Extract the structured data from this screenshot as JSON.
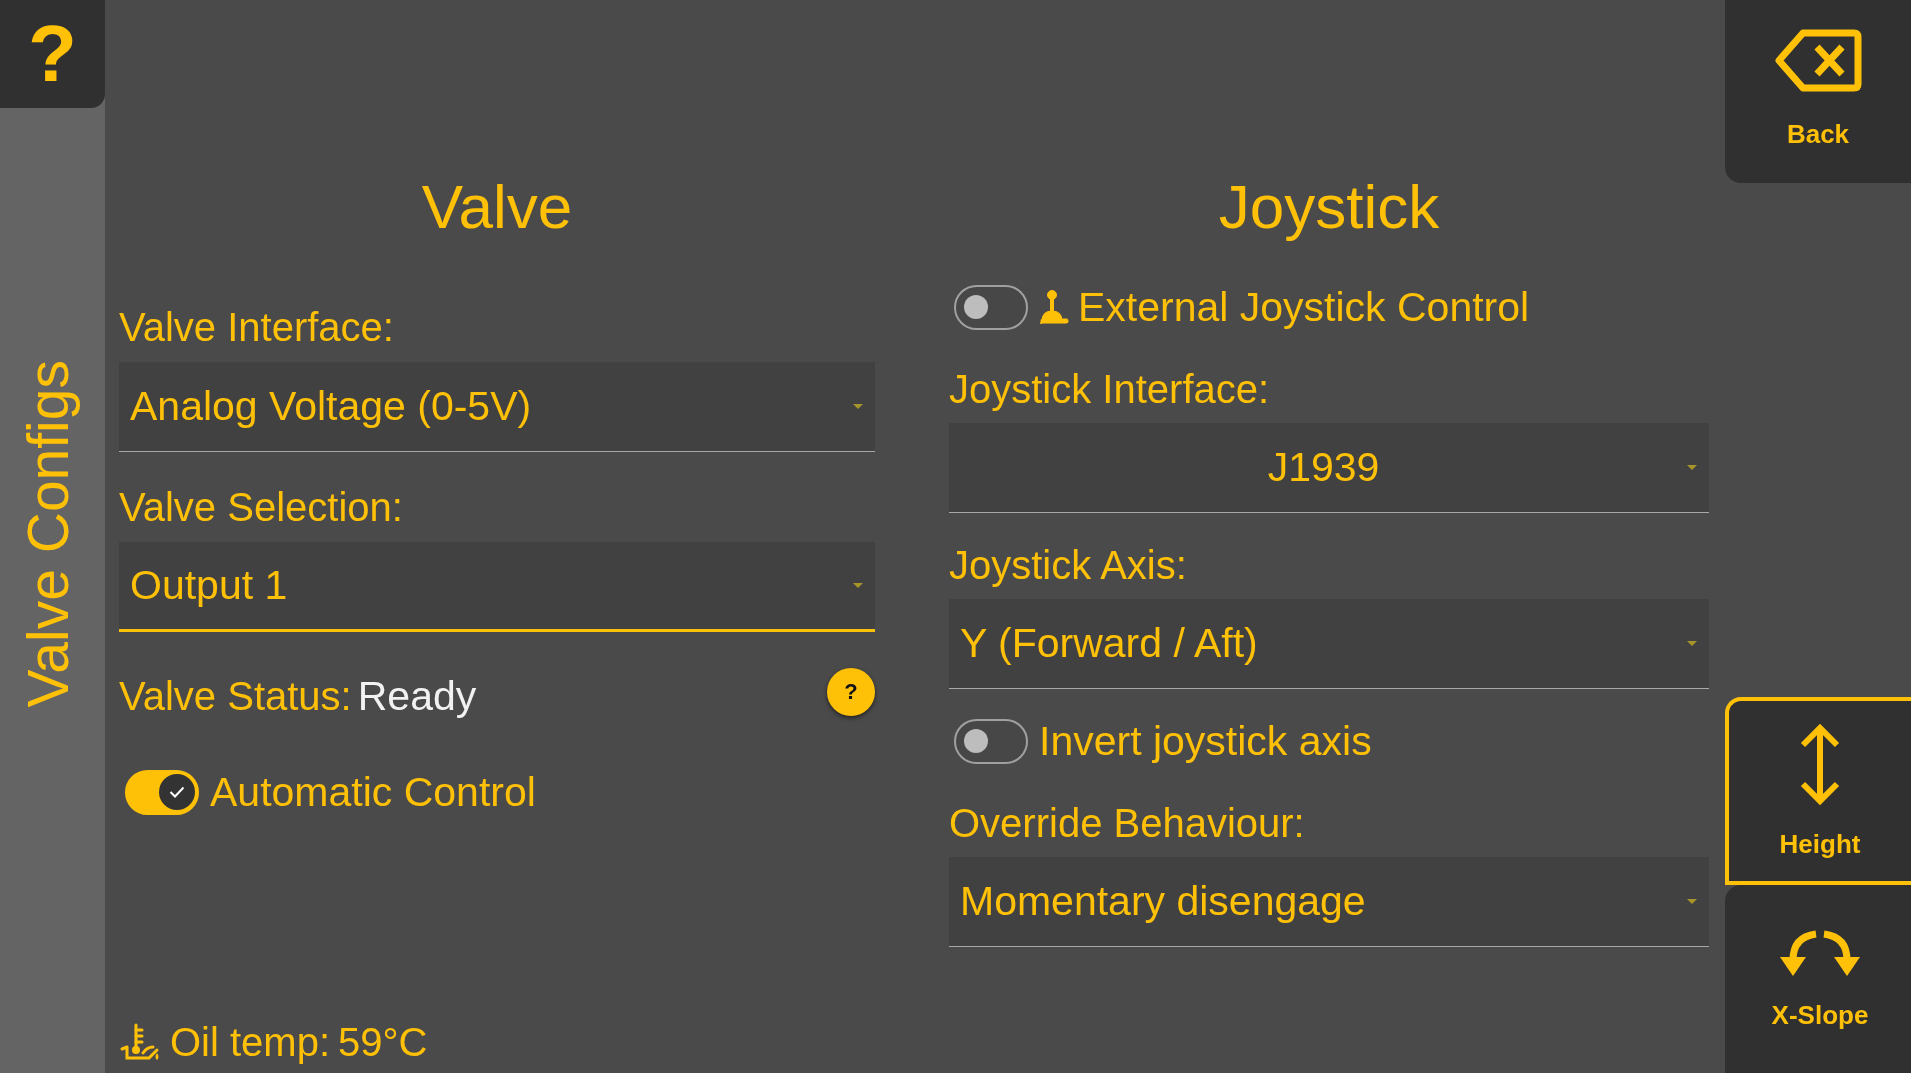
{
  "help_button": {
    "label": "?"
  },
  "sidebar": {
    "title": "Valve Configs"
  },
  "valve": {
    "title": "Valve",
    "fields": [
      {
        "label": "Valve Interface:",
        "value": "Analog Voltage (0-5V)",
        "focused": false
      },
      {
        "label": "Valve Selection:",
        "value": "Output 1",
        "focused": true
      }
    ],
    "status": {
      "label": "Valve Status:",
      "value": "Ready",
      "help_label": "?"
    },
    "toggle": {
      "label": "Automatic Control",
      "on": true
    }
  },
  "joystick": {
    "title": "Joystick",
    "items": [
      {
        "kind": "toggle",
        "label": "External Joystick Control",
        "on": false
      },
      {
        "kind": "select",
        "label": "Joystick Interface:",
        "value": "J1939",
        "focused": false
      },
      {
        "kind": "select",
        "label": "Joystick Axis:",
        "value": "Y (Forward / Aft)",
        "focused": false
      },
      {
        "kind": "toggle",
        "label": "Invert joystick axis",
        "on": false
      },
      {
        "kind": "select",
        "label": "Override Behaviour:",
        "value": "Momentary disengage",
        "focused": false
      }
    ]
  },
  "oil_temp": {
    "label": "Oil temp:",
    "value": "59°C"
  },
  "back_button": {
    "label": "Back"
  },
  "modes": [
    {
      "kind": "height",
      "label": "Height",
      "selected": true
    },
    {
      "kind": "slope",
      "label": "X-Slope",
      "selected": false
    }
  ]
}
